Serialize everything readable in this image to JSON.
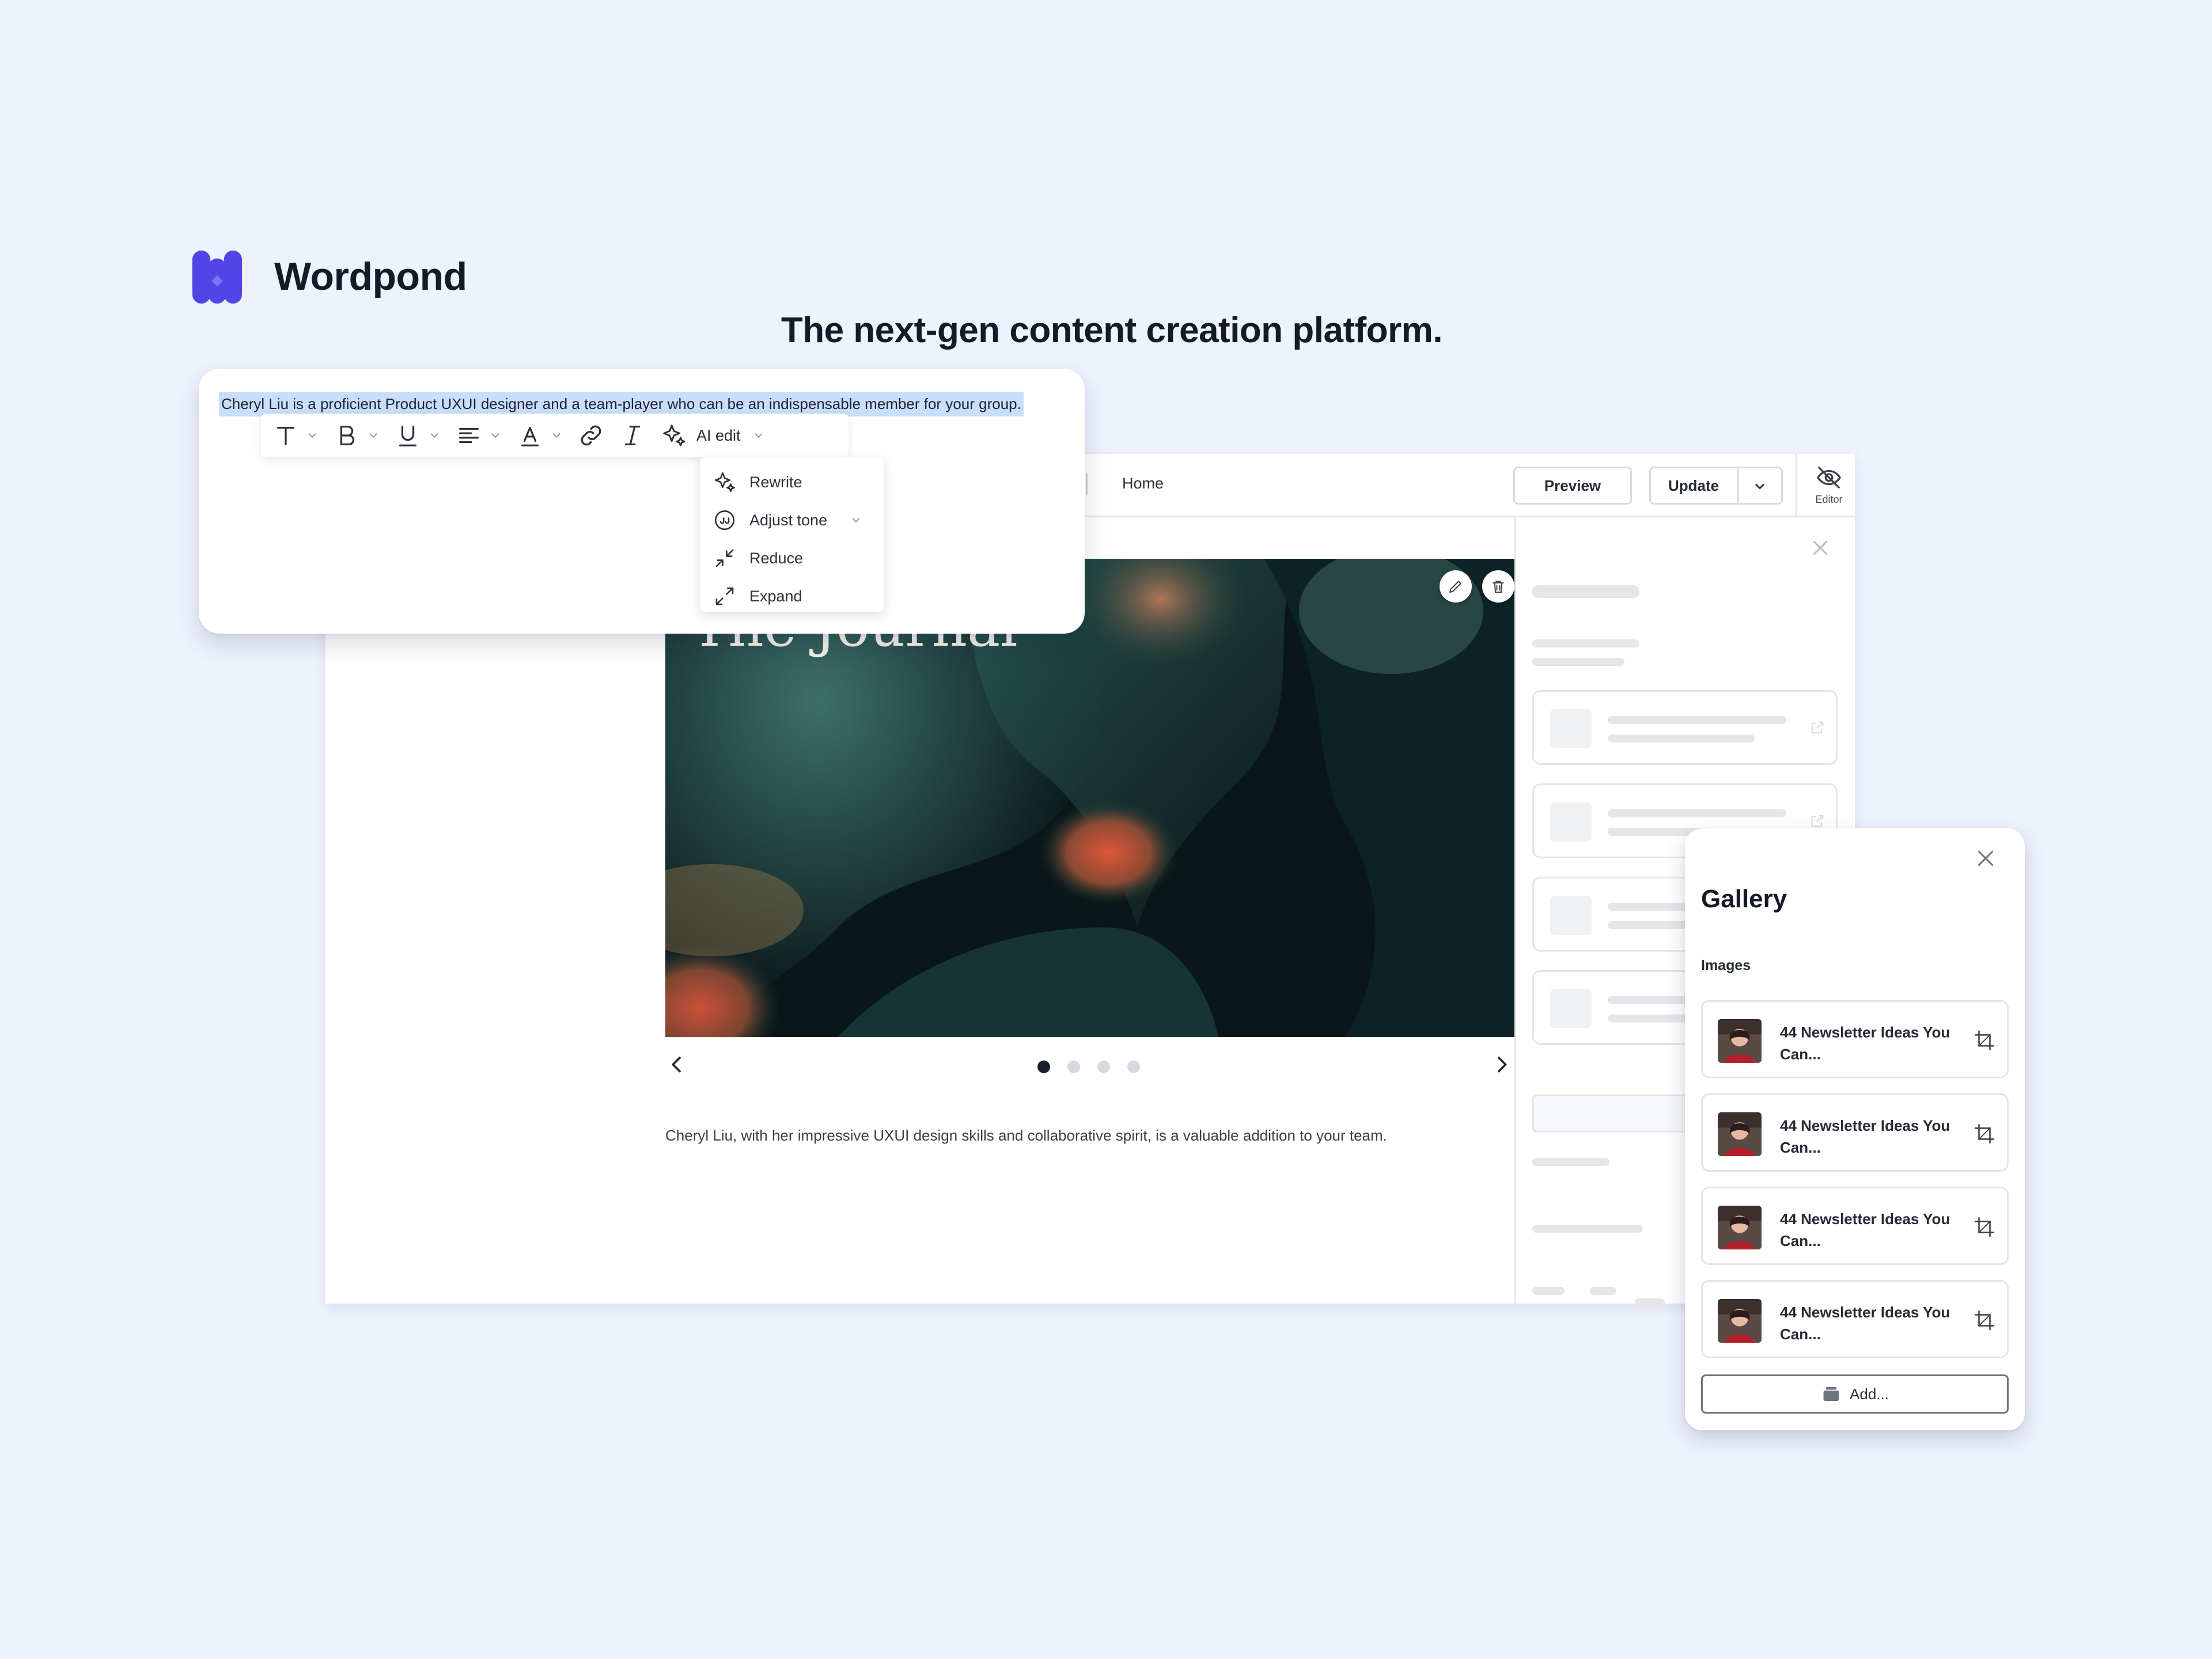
{
  "brand": {
    "name": "Wordpond",
    "logo_icon": "wordpond-logo-icon",
    "accent": "#4f46e5"
  },
  "tagline": "The next-gen content creation platform.",
  "editor": {
    "breadcrumb": {
      "current": "Home"
    },
    "buttons": {
      "preview": "Preview",
      "update": "Update"
    },
    "mode_toggle": {
      "label": "Editor",
      "icon": "eye-off-icon"
    },
    "hero": {
      "title": "The Journal",
      "actions": [
        "edit-icon",
        "trash-icon"
      ],
      "slide_count": 4,
      "active_slide": 1
    },
    "caption": "Cheryl Liu, with her impressive UXUI design skills and collaborative spirit, is a valuable addition to your team."
  },
  "text_editor": {
    "selected_text": "Cheryl Liu is a proficient Product UXUI designer and a team-player who can be an indispensable member for your group.",
    "toolbar": {
      "tools": [
        "text-style-icon",
        "bold-icon",
        "underline-icon",
        "align-left-icon",
        "text-color-icon",
        "link-icon",
        "italic-icon",
        "sparkles-icon"
      ],
      "ai_label": "AI edit"
    },
    "ai_menu": [
      {
        "label": "Rewrite",
        "icon": "sparkles-icon"
      },
      {
        "label": "Adjust tone",
        "icon": "quote-icon",
        "has_submenu": true
      },
      {
        "label": "Reduce",
        "icon": "minimize-icon"
      },
      {
        "label": "Expand",
        "icon": "maximize-icon"
      }
    ]
  },
  "gallery": {
    "title": "Gallery",
    "section": "Images",
    "items": [
      {
        "title": "44 Newsletter Ideas You Can..."
      },
      {
        "title": "44 Newsletter Ideas You Can..."
      },
      {
        "title": "44 Newsletter Ideas You Can..."
      },
      {
        "title": "44 Newsletter Ideas You Can..."
      }
    ],
    "add_label": "Add..."
  },
  "colors": {
    "page_bg": "#eef2fd",
    "selection": "#c9defc",
    "text_dark": "#161a26"
  }
}
